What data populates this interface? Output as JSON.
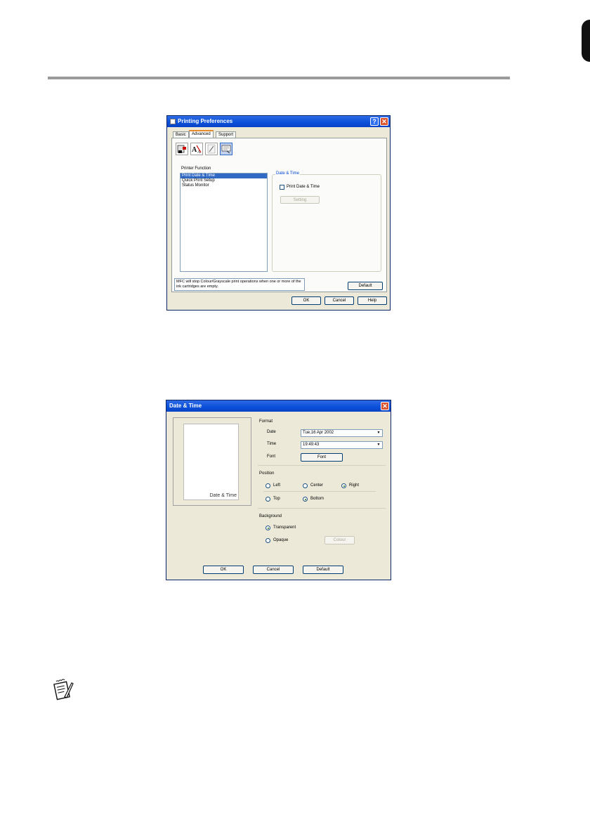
{
  "printing_preferences": {
    "title": "Printing Preferences",
    "tabs": [
      "Basic",
      "Advanced",
      "Support"
    ],
    "printer_function_label": "Printer Function",
    "printer_functions": [
      "Print Date & Time",
      "Quick Print Setup",
      "Status Monitor"
    ],
    "group_title": "Date & Time",
    "print_date_time_label": "Print Date & Time",
    "setting_button": "Setting",
    "status_message": "MFC will stop Colour/Grayscale print operations when one or more of the ink cartridges are empty.",
    "default_button": "Default",
    "ok_button": "OK",
    "cancel_button": "Cancel",
    "help_button": "Help"
  },
  "date_time_dialog": {
    "title": "Date & Time",
    "preview_text": "Date & Time",
    "format_label": "Format",
    "date_label": "Date",
    "date_value": "Tue,16 Apr 2002",
    "time_label": "Time",
    "time_value": "19:49:43",
    "font_label": "Font",
    "font_button": "Font",
    "position_label": "Position",
    "left_label": "Left",
    "center_label": "Center",
    "right_label": "Right",
    "top_label": "Top",
    "bottom_label": "Bottom",
    "background_label": "Background",
    "transparent_label": "Transparent",
    "opaque_label": "Opaque",
    "colour_button": "Colour",
    "ok_button": "OK",
    "cancel_button": "Cancel",
    "default_button": "Default"
  },
  "icons": [
    "printer-settings-icon",
    "watermark-icon",
    "pen-icon",
    "device-options-icon",
    "note-icon"
  ]
}
